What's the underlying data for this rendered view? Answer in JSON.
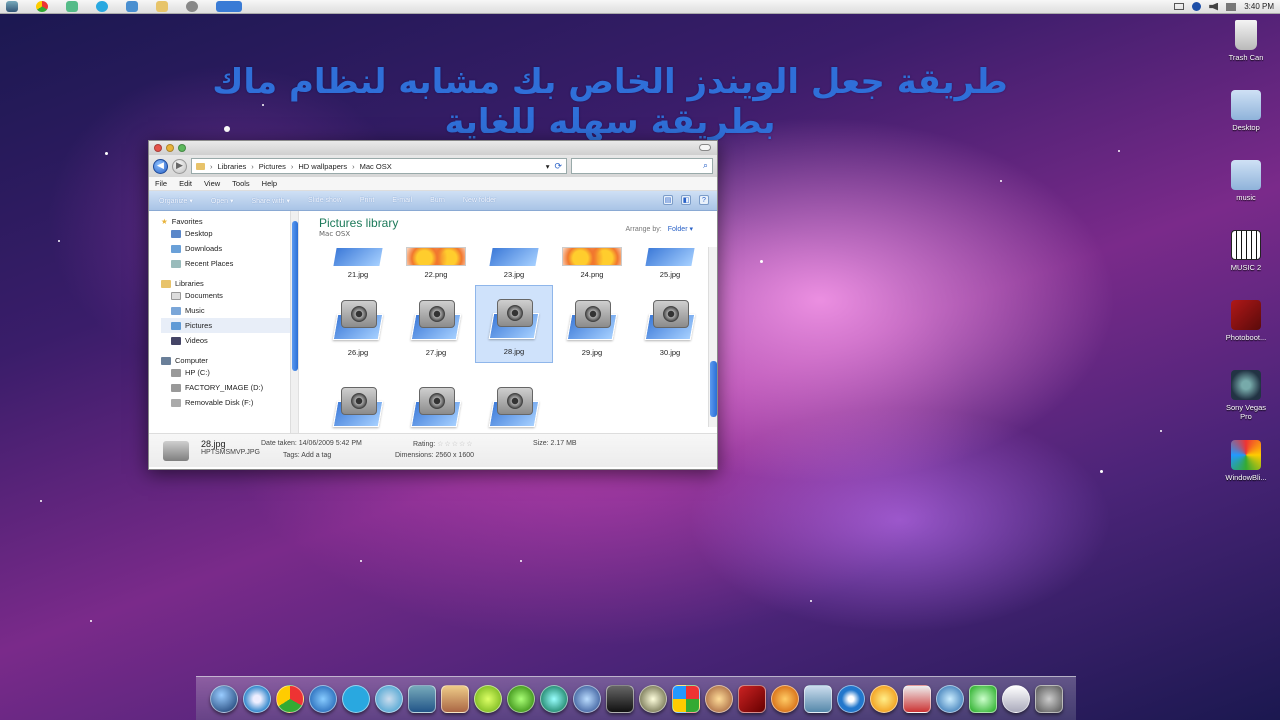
{
  "menubar": {
    "icons": [
      "apple-icon",
      "chrome-icon",
      "people-icon",
      "skype-icon",
      "globe-icon",
      "folder-icon",
      "network-icon",
      "window-icon"
    ],
    "time": "3:40 PM"
  },
  "headline": "طريقة جعل الويندز الخاص بك مشابه لنظام ماك بطريقة سهله للغاية",
  "desktop_icons": [
    {
      "label": "Trash Can",
      "icon": "trash-icon"
    },
    {
      "label": "Desktop",
      "icon": "folder-icon"
    },
    {
      "label": "music",
      "icon": "folder-icon"
    },
    {
      "label": "MUSIC 2",
      "icon": "piano-icon"
    },
    {
      "label": "Photoboot...",
      "icon": "photobooth-icon"
    },
    {
      "label": "Sony Vegas Pro",
      "icon": "vegas-icon"
    },
    {
      "label": "WindowBli...",
      "icon": "palette-icon"
    }
  ],
  "explorer": {
    "breadcrumb": [
      "Libraries",
      "Pictures",
      "HD wallpapers",
      "Mac OSX"
    ],
    "menu": [
      "File",
      "Edit",
      "View",
      "Tools",
      "Help"
    ],
    "toolbar": [
      "Organize",
      "Open",
      "Share with",
      "Slide show",
      "Print",
      "E-mail",
      "Burn",
      "New folder"
    ],
    "nav": {
      "favorites_label": "Favorites",
      "favorites": [
        "Desktop",
        "Downloads",
        "Recent Places"
      ],
      "libraries_label": "Libraries",
      "libraries": [
        "Documents",
        "Music",
        "Pictures",
        "Videos"
      ],
      "computer_label": "Computer",
      "drives": [
        "HP (C:)",
        "FACTORY_IMAGE (D:)",
        "Removable Disk (F:)"
      ]
    },
    "library": {
      "title": "Pictures library",
      "subtitle": "Mac OSX",
      "arrange_label": "Arrange by:",
      "arrange_value": "Folder"
    },
    "files_row1": [
      "21.jpg",
      "22.png",
      "23.jpg",
      "24.png",
      "25.jpg"
    ],
    "files_row2": [
      "26.jpg",
      "27.jpg",
      "28.jpg",
      "29.jpg",
      "30.jpg"
    ],
    "files_row3_count": 3,
    "selected_file": "28.jpg",
    "details": {
      "name": "28.jpg",
      "type": "HPTSMSMVP.JPG",
      "date_label": "Date taken:",
      "date_value": "14/06/2009 5:42 PM",
      "tags_label": "Tags:",
      "tags_value": "Add a tag",
      "rating_label": "Rating:",
      "rating_value": "☆☆☆☆☆",
      "dimensions_label": "Dimensions:",
      "dimensions_value": "2560 x 1600",
      "size_label": "Size:",
      "size_value": "2.17 MB"
    }
  },
  "dock_icons": [
    "finder-icon",
    "safari-icon",
    "chrome-icon",
    "ie-icon",
    "skype-icon",
    "itunes-icon",
    "mac-icon",
    "picture-icon",
    "lime-icon",
    "orb-icon",
    "chat-icon",
    "video-icon",
    "messenger-icon",
    "star-icon",
    "windows-icon",
    "guitar-icon",
    "photobooth-icon",
    "audio-icon",
    "image-icon",
    "w-icon",
    "sun-icon",
    "tools-icon",
    "media-icon",
    "xbox-icon",
    "wing-icon",
    "settings-icon"
  ]
}
